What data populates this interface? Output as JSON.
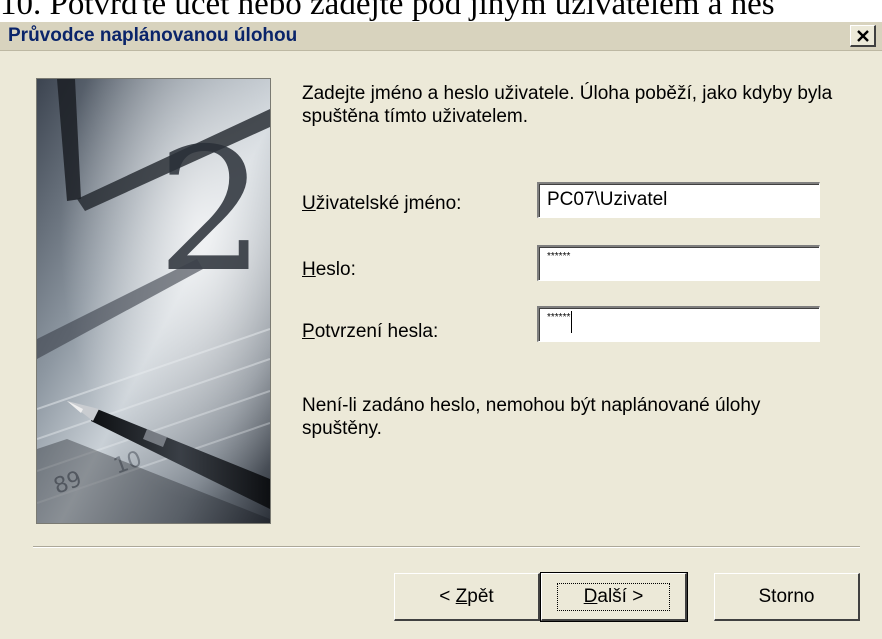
{
  "document": {
    "caption": "10. Potvrďte účet nebo zadejte pod jiným uživatelem a hes"
  },
  "window": {
    "title": "Průvodce naplánovanou úlohou",
    "close_label": "×"
  },
  "intro_text": "Zadejte jméno a heslo uživatele. Úloha poběží, jako kdyby byla spuštěna tímto uživatelem.",
  "fields": {
    "username": {
      "label_mnemonic": "U",
      "label_rest": "živatelské jméno:",
      "value": "PC07\\Uzivatel"
    },
    "password": {
      "label_mnemonic": "H",
      "label_rest": "eslo:",
      "value": "******"
    },
    "confirm": {
      "label_mnemonic": "P",
      "label_rest": "otvrzení hesla:",
      "value": "******"
    }
  },
  "note_text": "Není-li zadáno heslo, nemohou být naplánované úlohy spuštěny.",
  "buttons": {
    "back": {
      "prefix": "< ",
      "mnemonic": "Z",
      "rest": "pět"
    },
    "next": {
      "mnemonic": "D",
      "rest": "alší >"
    },
    "cancel": "Storno"
  },
  "colors": {
    "dialog_bg": "#ECE9D8",
    "title_text": "#0A246A"
  },
  "icons": {
    "close": "close-icon",
    "wizard_image": "clock-and-pen-illustration"
  }
}
